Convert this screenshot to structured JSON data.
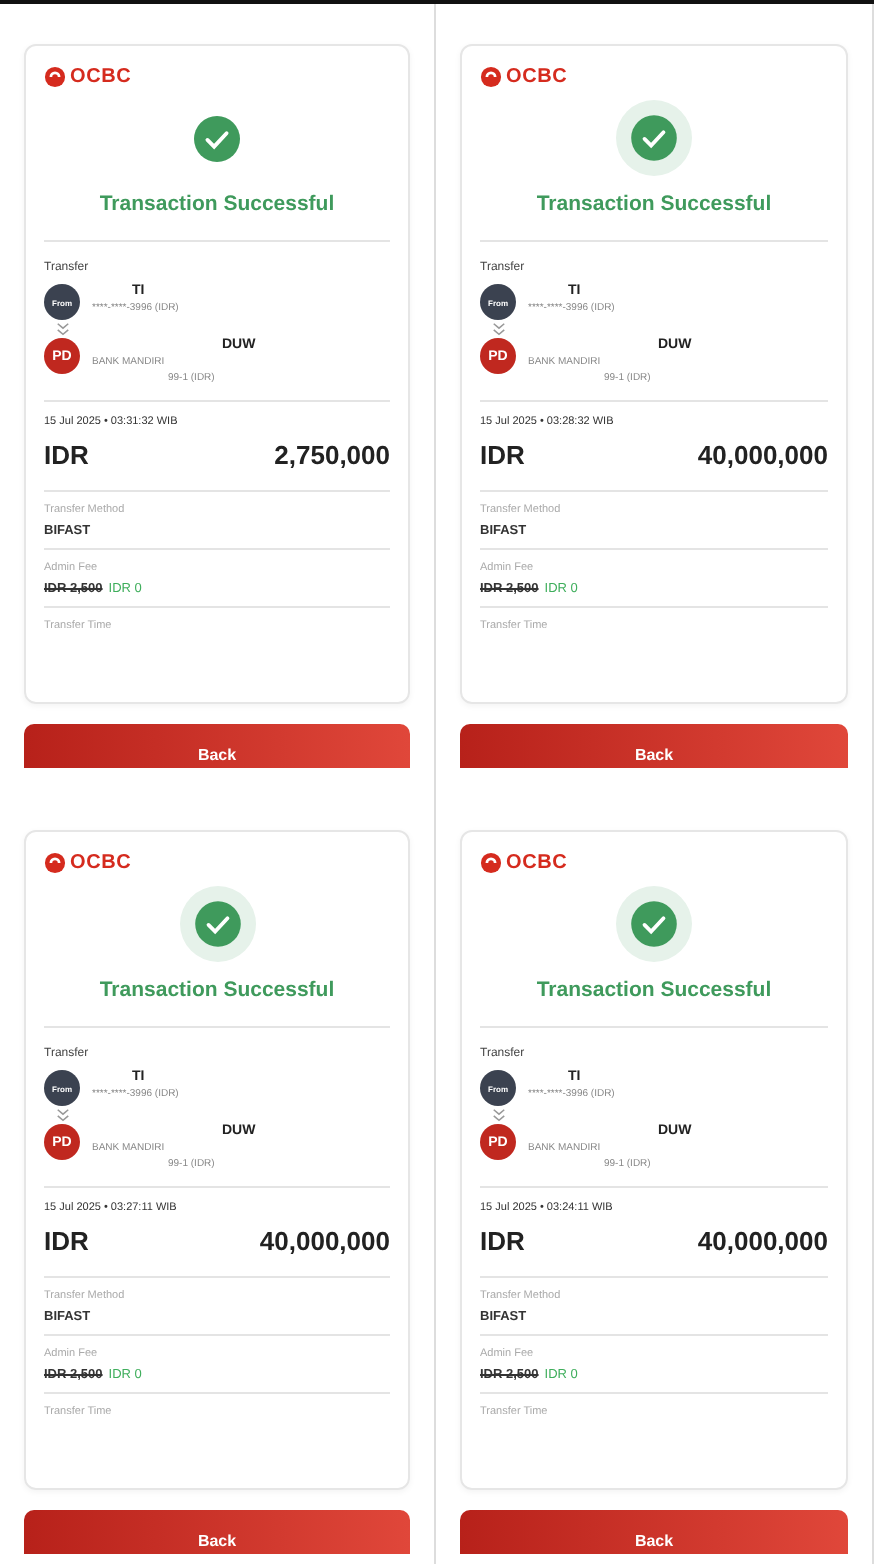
{
  "panels": [
    {
      "halo": false,
      "logo": "OCBC",
      "title": "Transaction Successful",
      "section": "Transfer",
      "from": {
        "badge": "From",
        "name": "TI",
        "account": "****-****-3996 (IDR)"
      },
      "to": {
        "initials": "PD",
        "name": "DUW",
        "bank": "BANK MANDIRI",
        "account": "99-1 (IDR)"
      },
      "datetime": "15 Jul 2025 • 03:31:32 WIB",
      "currency": "IDR",
      "amount": "2,750,000",
      "details": [
        {
          "kind": "text",
          "label": "Transfer Method",
          "value": "BIFAST"
        },
        {
          "kind": "fee",
          "label": "Admin Fee",
          "old": "IDR 2,500",
          "value": "IDR 0"
        },
        {
          "kind": "text",
          "label": "Transfer Time"
        }
      ],
      "button": "Back"
    },
    {
      "halo": true,
      "logo": "OCBC",
      "title": "Transaction Successful",
      "section": "Transfer",
      "from": {
        "badge": "From",
        "name": "TI",
        "account": "****-****-3996 (IDR)"
      },
      "to": {
        "initials": "PD",
        "name": "DUW",
        "bank": "BANK MANDIRI",
        "account": "99-1 (IDR)"
      },
      "datetime": "15 Jul 2025 • 03:28:32 WIB",
      "currency": "IDR",
      "amount": "40,000,000",
      "details": [
        {
          "kind": "text",
          "label": "Transfer Method",
          "value": "BIFAST"
        },
        {
          "kind": "fee",
          "label": "Admin Fee",
          "old": "IDR 2,500",
          "value": "IDR 0"
        },
        {
          "kind": "text",
          "label": "Transfer Time"
        }
      ],
      "button": "Back"
    },
    {
      "halo": true,
      "logo": "OCBC",
      "title": "Transaction Successful",
      "section": "Transfer",
      "from": {
        "badge": "From",
        "name": "TI",
        "account": "****-****-3996 (IDR)"
      },
      "to": {
        "initials": "PD",
        "name": "DUW",
        "bank": "BANK MANDIRI",
        "account": "99-1 (IDR)"
      },
      "datetime": "15 Jul 2025 • 03:27:11 WIB",
      "currency": "IDR",
      "amount": "40,000,000",
      "details": [
        {
          "kind": "text",
          "label": "Transfer Method",
          "value": "BIFAST"
        },
        {
          "kind": "fee",
          "label": "Admin Fee",
          "old": "IDR 2,500",
          "value": "IDR 0"
        },
        {
          "kind": "text",
          "label": "Transfer Time"
        }
      ],
      "button": "Back"
    },
    {
      "halo": true,
      "logo": "OCBC",
      "title": "Transaction Successful",
      "section": "Transfer",
      "from": {
        "badge": "From",
        "name": "TI",
        "account": "****-****-3996 (IDR)"
      },
      "to": {
        "initials": "PD",
        "name": "DUW",
        "bank": "BANK MANDIRI",
        "account": "99-1 (IDR)"
      },
      "datetime": "15 Jul 2025 • 03:24:11 WIB",
      "currency": "IDR",
      "amount": "40,000,000",
      "details": [
        {
          "kind": "text",
          "label": "Transfer Method",
          "value": "BIFAST"
        },
        {
          "kind": "fee",
          "label": "Admin Fee",
          "old": "IDR 2,500",
          "value": "IDR 0"
        },
        {
          "kind": "text",
          "label": "Transfer Time"
        }
      ],
      "button": "Back"
    }
  ]
}
